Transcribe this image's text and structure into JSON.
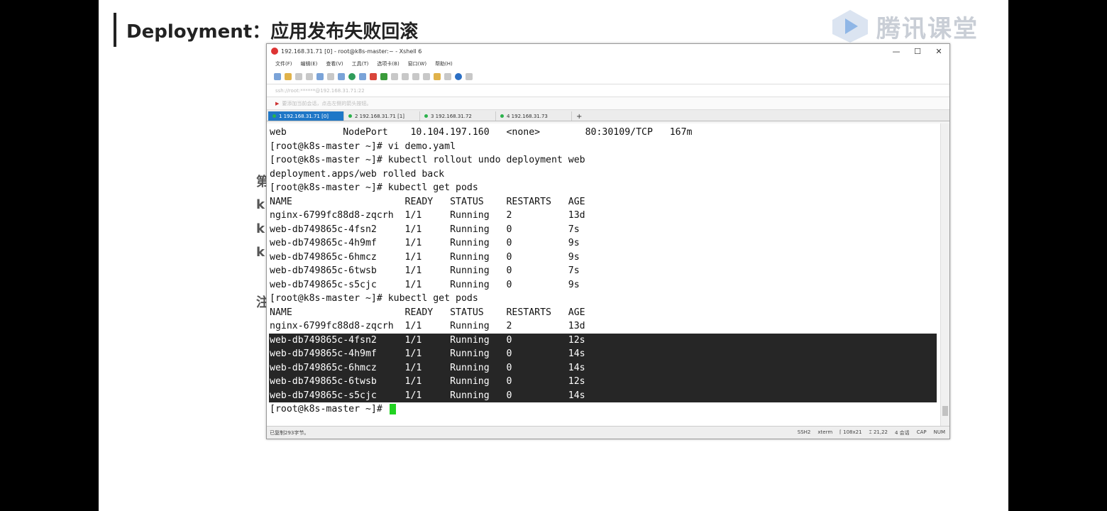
{
  "slide": {
    "title": "Deployment：应用发布失败回滚",
    "logo_text": "腾讯课堂",
    "bg_chars": [
      "第",
      "k",
      "k",
      "k",
      "注"
    ]
  },
  "window": {
    "title": "192.168.31.71 [0] - root@k8s-master:~ - Xshell 6",
    "controls": [
      "—",
      "☐",
      "✕"
    ],
    "menu": [
      "文件(F)",
      "编辑(E)",
      "查看(V)",
      "工具(T)",
      "选项卡(B)",
      "窗口(W)",
      "帮助(H)"
    ],
    "address": "ssh://root:******@192.168.31.71:22",
    "hint": "要添加当前会话，点击左侧的箭头按钮。",
    "tabs": [
      {
        "label": "1 192.168.31.71 [0]",
        "active": true
      },
      {
        "label": "2 192.168.31.71 [1]",
        "active": false
      },
      {
        "label": "3 192.168.31.72",
        "active": false
      },
      {
        "label": "4 192.168.31.73",
        "active": false
      }
    ],
    "tab_add": "+",
    "status_left": "已复制293字节。",
    "status_right": [
      "SSH2",
      "xterm",
      "⌈ 108x21",
      "⌶ 21,22",
      "4 会话",
      "CAP",
      "NUM"
    ]
  },
  "terminal": {
    "lines": [
      "web          NodePort    10.104.197.160   <none>        80:30109/TCP   167m",
      "[root@k8s-master ~]# vi demo.yaml",
      "[root@k8s-master ~]# kubectl rollout undo deployment web",
      "deployment.apps/web rolled back",
      "[root@k8s-master ~]# kubectl get pods",
      "NAME                    READY   STATUS    RESTARTS   AGE",
      "nginx-6799fc88d8-zqcrh  1/1     Running   2          13d",
      "web-db749865c-4fsn2     1/1     Running   0          7s",
      "web-db749865c-4h9mf     1/1     Running   0          9s",
      "web-db749865c-6hmcz     1/1     Running   0          9s",
      "web-db749865c-6twsb     1/1     Running   0          7s",
      "web-db749865c-s5cjc     1/1     Running   0          9s",
      "[root@k8s-master ~]# kubectl get pods",
      "NAME                    READY   STATUS    RESTARTS   AGE",
      "nginx-6799fc88d8-zqcrh  1/1     Running   2          13d",
      "web-db749865c-4fsn2     1/1     Running   0          12s",
      "web-db749865c-4h9mf     1/1     Running   0          14s",
      "web-db749865c-6hmcz     1/1     Running   0          14s",
      "web-db749865c-6twsb     1/1     Running   0          12s",
      "web-db749865c-s5cjc     1/1     Running   0          14s",
      "[root@k8s-master ~]# "
    ],
    "selected_lines": [
      15,
      16,
      17,
      18,
      19
    ],
    "colors": {
      "selection_bg": "#262626",
      "cursor": "#21d321",
      "tab_active": "#1f77c7"
    }
  }
}
